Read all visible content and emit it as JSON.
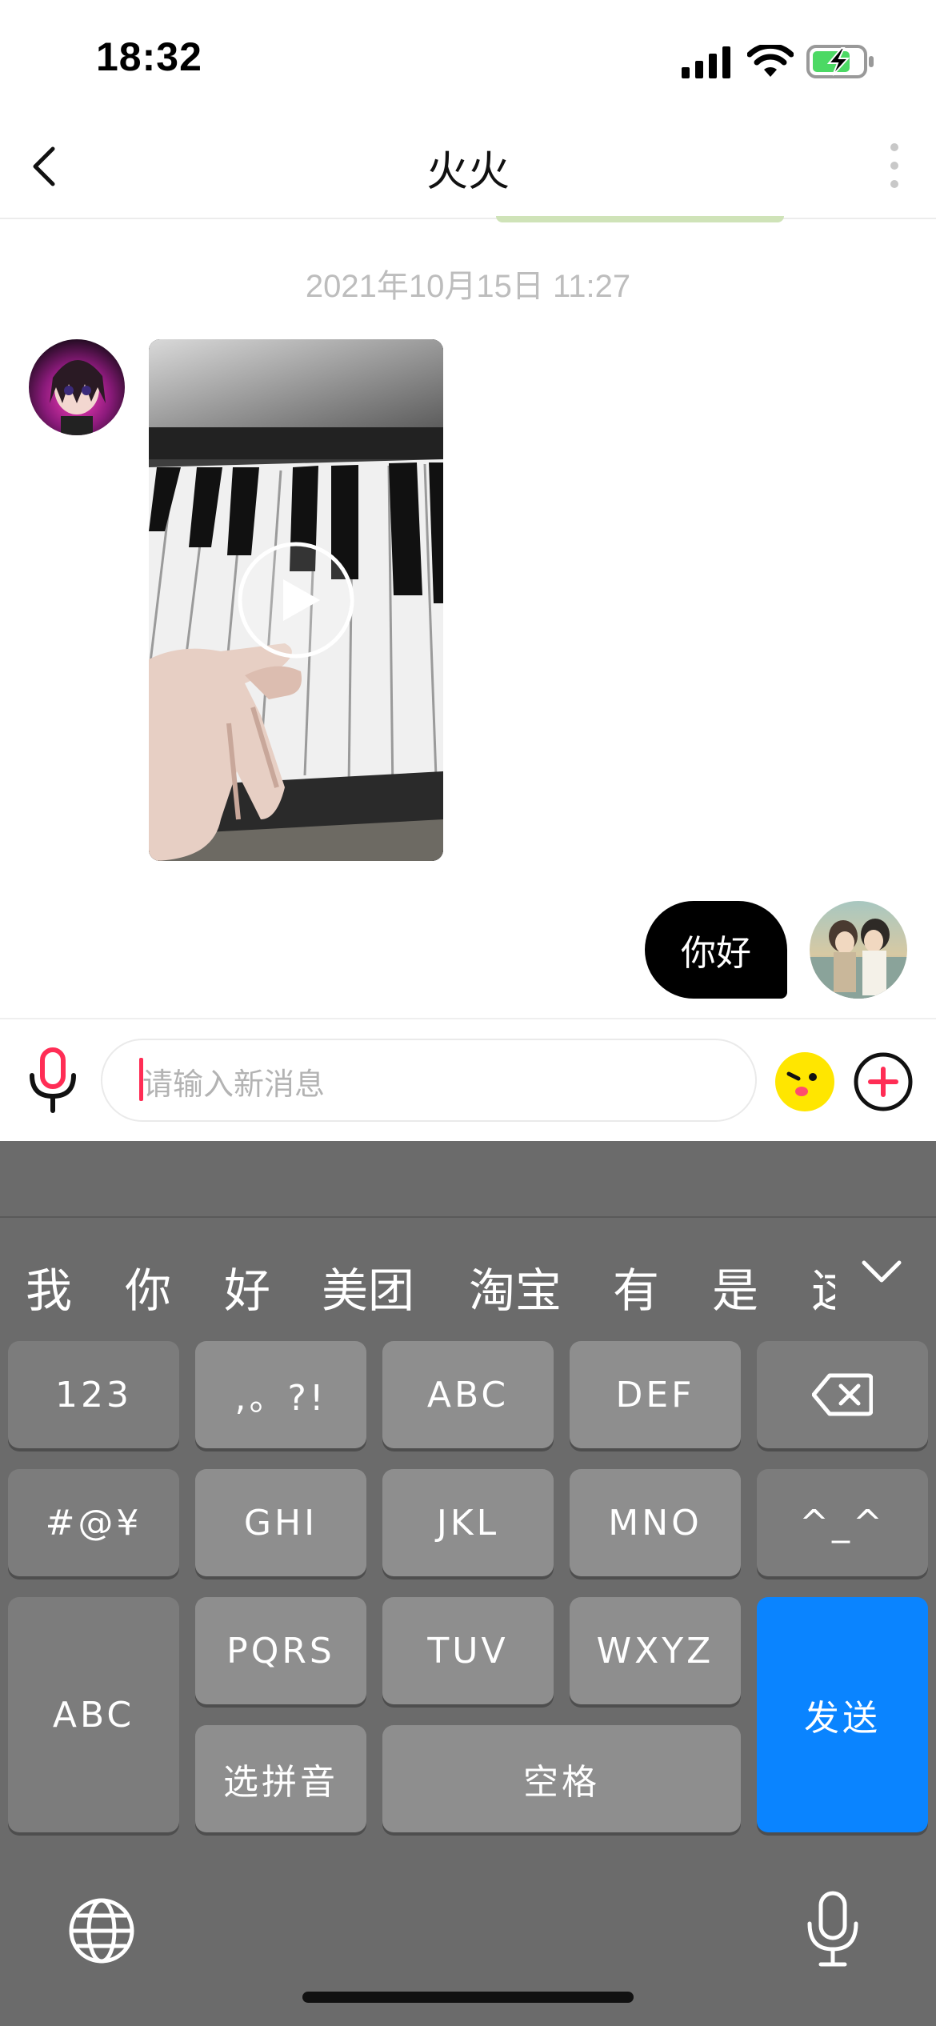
{
  "status_bar": {
    "time": "18:32"
  },
  "nav": {
    "title": "火火"
  },
  "chat": {
    "timestamp": "2021年10月15日 11:27",
    "messages": [
      {
        "from": "other",
        "type": "video"
      },
      {
        "from": "self",
        "type": "text",
        "text": "你好"
      }
    ]
  },
  "input": {
    "placeholder": "请输入新消息"
  },
  "keyboard": {
    "candidates": [
      "我",
      "你",
      "好",
      "美团",
      "淘宝",
      "有",
      "是",
      "这"
    ],
    "keys": {
      "k123": "123",
      "punct": ",。?!",
      "abc": "ABC",
      "def": "DEF",
      "symbols": "#@¥",
      "ghi": "GHI",
      "jkl": "JKL",
      "mno": "MNO",
      "emoticon": "^_^",
      "abc_switch": "ABC",
      "pqrs": "PQRS",
      "tuv": "TUV",
      "wxyz": "WXYZ",
      "send": "发送",
      "pinyin": "选拼音",
      "space": "空格"
    }
  },
  "colors": {
    "accent": "#0a84ff",
    "send_bubble": "#000000",
    "caret": "#ff2d55",
    "battery": "#4cd964"
  },
  "icons": [
    "back-icon",
    "more-icon",
    "signal-icon",
    "wifi-icon",
    "battery-icon",
    "mic-icon",
    "emoji-icon",
    "plus-icon",
    "play-icon",
    "delete-icon",
    "collapse-icon",
    "globe-icon",
    "dictation-icon"
  ]
}
